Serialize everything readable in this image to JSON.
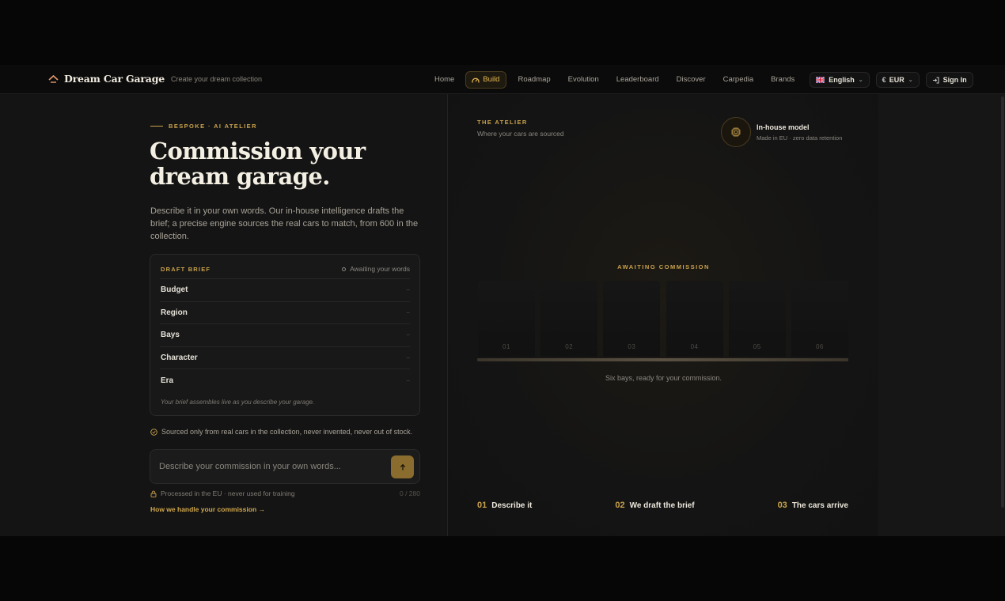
{
  "header": {
    "brand_name": "Dream Car Garage",
    "brand_tagline": "Create your dream collection",
    "nav": [
      {
        "label": "Home",
        "active": false
      },
      {
        "label": "Build",
        "active": true
      },
      {
        "label": "Roadmap",
        "active": false
      },
      {
        "label": "Evolution",
        "active": false
      },
      {
        "label": "Leaderboard",
        "active": false
      },
      {
        "label": "Discover",
        "active": false
      },
      {
        "label": "Carpedia",
        "active": false
      },
      {
        "label": "Brands",
        "active": false
      }
    ],
    "language": "English",
    "currency": "EUR",
    "currency_symbol": "€",
    "sign_in": "Sign In"
  },
  "left": {
    "eyebrow": "BESPOKE · AI ATELIER",
    "headline": "Commission your dream garage.",
    "lede": "Describe it in your own words. Our in-house intelligence drafts the brief; a precise engine sources the real cars to match, from 600 in the collection.",
    "brief": {
      "title": "DRAFT BRIEF",
      "status": "Awaiting your words",
      "rows": [
        {
          "label": "Budget",
          "value": "–"
        },
        {
          "label": "Region",
          "value": "–"
        },
        {
          "label": "Bays",
          "value": "–"
        },
        {
          "label": "Character",
          "value": "–"
        },
        {
          "label": "Era",
          "value": "–"
        }
      ],
      "footnote": "Your brief assembles live as you describe your garage."
    },
    "sourced_note": "Sourced only from real cars in the collection, never invented, never out of stock.",
    "composer": {
      "placeholder": "Describe your commission in your own words...",
      "value": ""
    },
    "privacy_note": "Processed in the EU · never used for training",
    "counter": "0 / 280",
    "how_link": "How we handle your commission →"
  },
  "right": {
    "title": "THE ATELIER",
    "subtitle": "Where your cars are sourced",
    "model_title": "In-house model",
    "model_sub": "Made in EU · zero data retention",
    "awaiting": "AWAITING COMMISSION",
    "bays": [
      "01",
      "02",
      "03",
      "04",
      "05",
      "06"
    ],
    "bays_caption": "Six bays, ready for your commission.",
    "steps": [
      {
        "num": "01",
        "label": "Describe it"
      },
      {
        "num": "02",
        "label": "We draft the brief"
      },
      {
        "num": "03",
        "label": "The cars arrive"
      }
    ]
  },
  "colors": {
    "accent": "#c9a24a",
    "background": "#141414",
    "send_button": "#8a6d2e"
  },
  "icons": {
    "brand": "roof-icon",
    "build": "speedometer-icon",
    "sign_in": "login-arrow-icon",
    "model": "chip-icon",
    "sourced": "check-circle-icon",
    "privacy": "lock-icon",
    "send": "arrow-up-icon"
  }
}
